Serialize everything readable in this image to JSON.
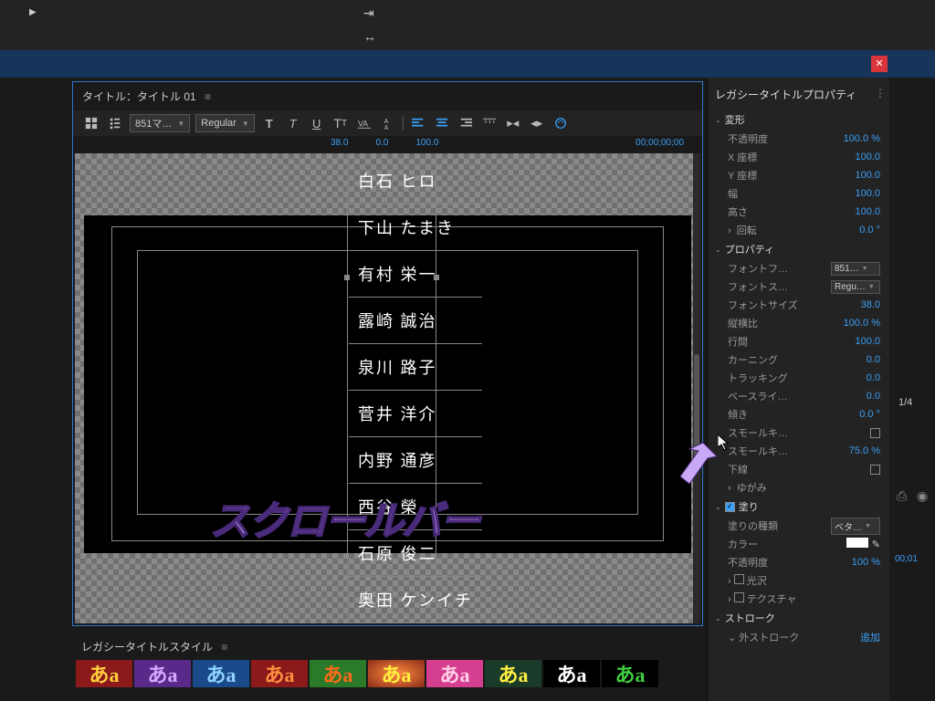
{
  "title_panel": {
    "label": "タイトル：タイトル 01"
  },
  "toolbar": {
    "font_family": "851マ…",
    "font_style": "Regular",
    "val1": "38.0",
    "val2": "0.0",
    "val3": "100.0",
    "timecode": "00;00;00;00"
  },
  "credits": [
    "白石 ヒロ",
    "下山 たまき",
    "有村 栄一",
    "露崎 誠治",
    "泉川 路子",
    "菅井 洋介",
    "内野 通彦",
    "西谷 榮",
    "石原 俊二",
    "奥田 ケンイチ"
  ],
  "styles_panel": {
    "label": "レガシータイトルスタイル",
    "glyph": "あa"
  },
  "props_panel": {
    "header": "レガシータイトルプロパティ",
    "s_transform": "変形",
    "opacity": {
      "l": "不透明度",
      "v": "100.0 %"
    },
    "xpos": {
      "l": "X 座標",
      "v": "100.0"
    },
    "ypos": {
      "l": "Y 座標",
      "v": "100.0"
    },
    "width": {
      "l": "幅",
      "v": "100.0"
    },
    "height": {
      "l": "高さ",
      "v": "100.0"
    },
    "rotation": {
      "l": "回転",
      "v": "0.0 °"
    },
    "s_property": "プロパティ",
    "fontfam": {
      "l": "フォントフ…",
      "v": "851…"
    },
    "fontsty": {
      "l": "フォントス…",
      "v": "Regu…"
    },
    "fontsize": {
      "l": "フォントサイズ",
      "v": "38.0"
    },
    "aspect": {
      "l": "縦横比",
      "v": "100.0 %"
    },
    "leading": {
      "l": "行間",
      "v": "100.0"
    },
    "kerning": {
      "l": "カーニング",
      "v": "0.0"
    },
    "tracking": {
      "l": "トラッキング",
      "v": "0.0"
    },
    "baseline": {
      "l": "ベースライ…",
      "v": "0.0"
    },
    "slant": {
      "l": "傾き",
      "v": "0.0 °"
    },
    "smallcaps": {
      "l": "スモールキ…"
    },
    "smallcapssz": {
      "l": "スモールキ…",
      "v": "75.0 %"
    },
    "underline": {
      "l": "下線"
    },
    "distort": {
      "l": "ゆがみ"
    },
    "s_fill": "塗り",
    "filltype": {
      "l": "塗りの種類",
      "v": "ベタ…"
    },
    "color": {
      "l": "カラー"
    },
    "fillopacity": {
      "l": "不透明度",
      "v": "100 %"
    },
    "sheen": {
      "l": "光沢"
    },
    "texture": {
      "l": "テクスチャ"
    },
    "s_stroke": "ストローク",
    "outer": {
      "l": "外ストローク",
      "v": "追加"
    }
  },
  "farright": {
    "frac": "1/4",
    "tc": "00;01"
  },
  "annotation": "スクロールバー"
}
